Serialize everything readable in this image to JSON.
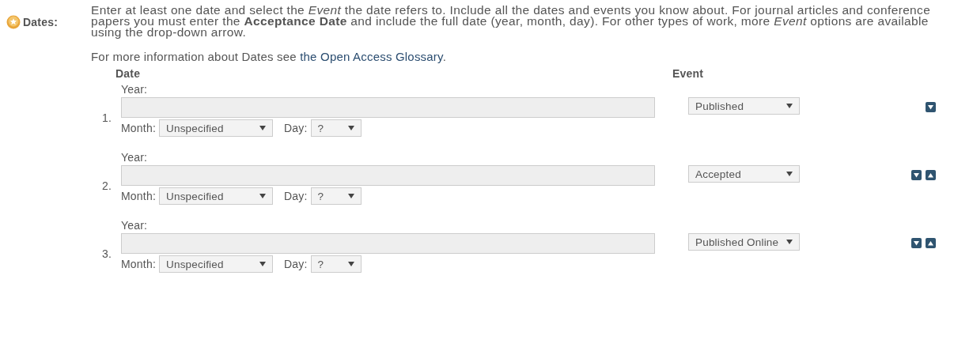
{
  "section": {
    "label": "Dates:",
    "intro": "Enter at least one date and select the *Event* the date refers to. Include all the dates and events you know about. For journal articles and conference papers you must enter the **Acceptance Date** and include the full date (year, month, day). For other types of work, more *Event* options are available using the drop-down arrow.",
    "more_info": "For more information about Dates see",
    "link": "the Open Access Glossary",
    "more_info_end": "."
  },
  "columns": [
    "Date",
    "Event"
  ],
  "rows": [
    {
      "number": "1.",
      "year_label": "Year:",
      "month_label": "Month:",
      "month": "Unspecified",
      "day_label": "Day:",
      "day": "?",
      "event": "Published",
      "can_move_down": true,
      "can_move_up": false
    },
    {
      "number": "2.",
      "year_label": "Year:",
      "month_label": "Month:",
      "month": "Unspecified",
      "day_label": "Day:",
      "day": "?",
      "event": "Accepted",
      "can_move_down": true,
      "can_move_up": true
    },
    {
      "number": "3.",
      "year_label": "Year:",
      "month_label": "Month:",
      "month": "Unspecified",
      "day_label": "Day:",
      "day": "?",
      "event": "Published Online",
      "can_move_down": true,
      "can_move_up": true
    }
  ]
}
